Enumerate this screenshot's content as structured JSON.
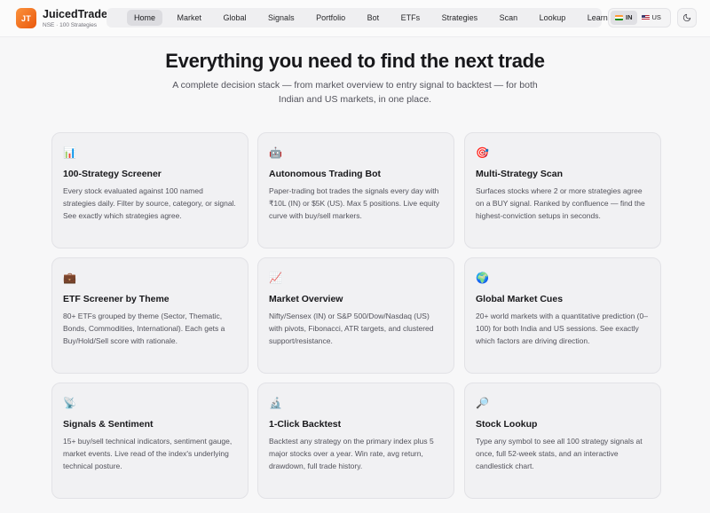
{
  "brand": {
    "logo": "JT",
    "name": "JuicedTrade",
    "subtitle": "NSE · 100 Strategies"
  },
  "nav": {
    "items": [
      {
        "label": "Home",
        "active": true
      },
      {
        "label": "Market"
      },
      {
        "label": "Global"
      },
      {
        "label": "Signals"
      },
      {
        "label": "Portfolio"
      },
      {
        "label": "Bot"
      },
      {
        "label": "ETFs"
      },
      {
        "label": "Strategies"
      },
      {
        "label": "Scan"
      },
      {
        "label": "Lookup"
      },
      {
        "label": "Learn"
      }
    ]
  },
  "market_toggle": {
    "options": [
      {
        "label": "IN",
        "flag": "india-flag",
        "active": true
      },
      {
        "label": "US",
        "flag": "us-flag"
      }
    ]
  },
  "theme_toggle": {
    "icon": "moon-icon"
  },
  "hero": {
    "title": "Everything you need to find the next trade",
    "subtitle": "A complete decision stack — from market overview to entry signal to backtest — for both Indian and US markets, in one place."
  },
  "features": [
    {
      "icon": "📊",
      "icon_name": "bar-chart-icon",
      "title": "100-Strategy Screener",
      "description": "Every stock evaluated against 100 named strategies daily. Filter by source, category, or signal. See exactly which strategies agree."
    },
    {
      "icon": "🤖",
      "icon_name": "robot-icon",
      "title": "Autonomous Trading Bot",
      "description": "Paper-trading bot trades the signals every day with ₹10L (IN) or $5K (US). Max 5 positions. Live equity curve with buy/sell markers."
    },
    {
      "icon": "🎯",
      "icon_name": "target-icon",
      "title": "Multi-Strategy Scan",
      "description": "Surfaces stocks where 2 or more strategies agree on a BUY signal. Ranked by confluence — find the highest-conviction setups in seconds."
    },
    {
      "icon": "💼",
      "icon_name": "briefcase-icon",
      "title": "ETF Screener by Theme",
      "description": "80+ ETFs grouped by theme (Sector, Thematic, Bonds, Commodities, International). Each gets a Buy/Hold/Sell score with rationale."
    },
    {
      "icon": "📈",
      "icon_name": "trend-chart-icon",
      "title": "Market Overview",
      "description": "Nifty/Sensex (IN) or S&P 500/Dow/Nasdaq (US) with pivots, Fibonacci, ATR targets, and clustered support/resistance."
    },
    {
      "icon": "🌍",
      "icon_name": "globe-icon",
      "title": "Global Market Cues",
      "description": "20+ world markets with a quantitative prediction (0–100) for both India and US sessions. See exactly which factors are driving direction."
    },
    {
      "icon": "📡",
      "icon_name": "satellite-antenna-icon",
      "title": "Signals & Sentiment",
      "description": "15+ buy/sell technical indicators, sentiment gauge, market events. Live read of the index's underlying technical posture."
    },
    {
      "icon": "🔬",
      "icon_name": "microscope-icon",
      "title": "1-Click Backtest",
      "description": "Backtest any strategy on the primary index plus 5 major stocks over a year. Win rate, avg return, drawdown, full trade history."
    },
    {
      "icon": "🔎",
      "icon_name": "magnifier-icon",
      "title": "Stock Lookup",
      "description": "Type any symbol to see all 100 strategy signals at once, full 52-week stats, and an interactive candlestick chart."
    }
  ]
}
